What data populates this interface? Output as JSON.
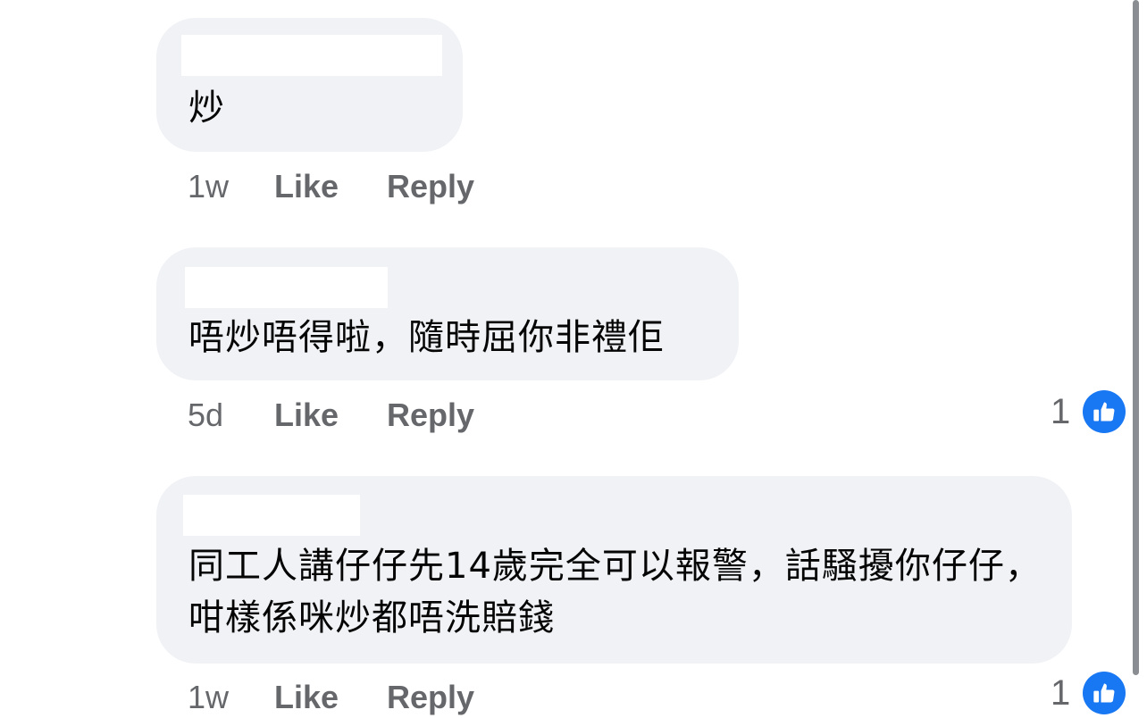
{
  "comments": [
    {
      "text": "炒",
      "time": "1w",
      "like_label": "Like",
      "reply_label": "Reply",
      "reaction_count": ""
    },
    {
      "text": "唔炒唔得啦，隨時屈你非禮佢",
      "time": "5d",
      "like_label": "Like",
      "reply_label": "Reply",
      "reaction_count": "1"
    },
    {
      "text": "同工人講仔仔先14歲完全可以報警，話騷擾你仔仔，咁樣係咪炒都唔洗賠錢",
      "time": "1w",
      "like_label": "Like",
      "reply_label": "Reply",
      "reaction_count": "1"
    }
  ],
  "reaction_icon": "thumbs-up-icon",
  "colors": {
    "bubble_bg": "#f0f2f5",
    "meta_text": "#65676b",
    "like_badge": "#1877f2"
  }
}
